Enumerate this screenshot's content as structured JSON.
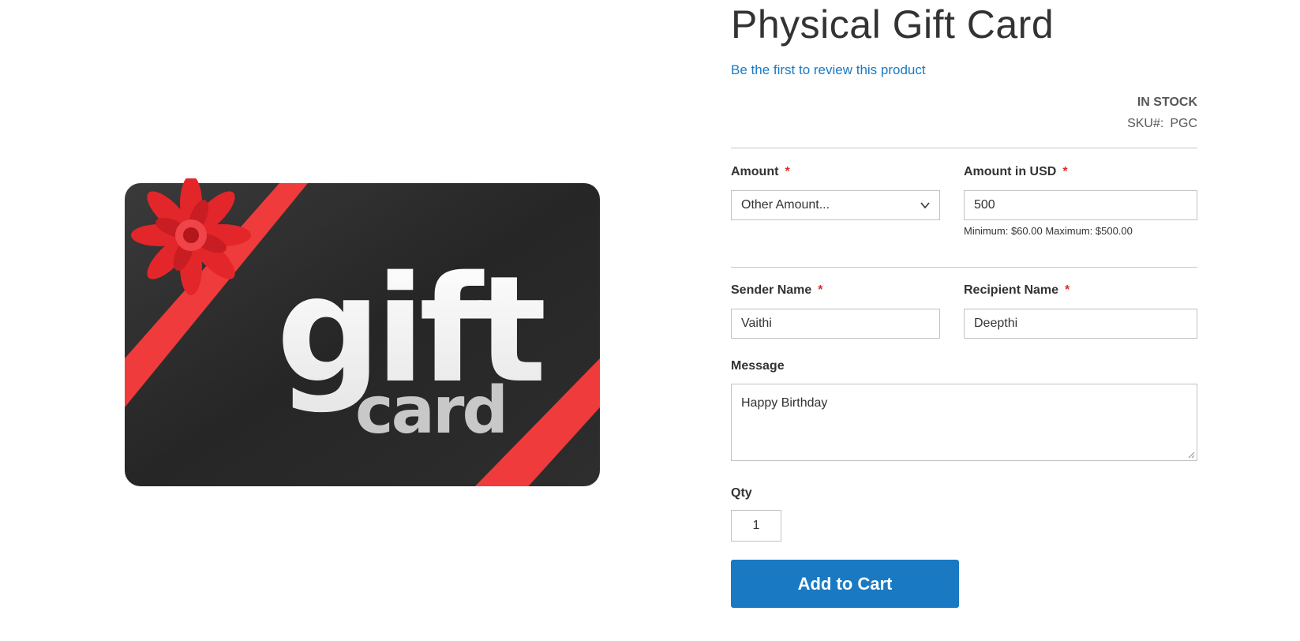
{
  "product": {
    "title": "Physical Gift Card",
    "review_link": "Be the first to review this product",
    "stock_status": "In stock",
    "sku_label": "SKU#:",
    "sku_value": "PGC"
  },
  "media": {
    "word_top": "gift",
    "word_bottom": "card",
    "card_color": "#2b2b2b",
    "ribbon_color": "#ef3b3b"
  },
  "form": {
    "amount": {
      "label": "Amount",
      "required_mark": "*",
      "selected": "Other Amount..."
    },
    "amount_usd": {
      "label": "Amount in USD",
      "required_mark": "*",
      "value": "500",
      "note": "Minimum: $60.00 Maximum: $500.00"
    },
    "sender": {
      "label": "Sender Name",
      "required_mark": "*",
      "value": "Vaithi"
    },
    "recipient": {
      "label": "Recipient Name",
      "required_mark": "*",
      "value": "Deepthi"
    },
    "message": {
      "label": "Message",
      "value": "Happy Birthday"
    },
    "qty": {
      "label": "Qty",
      "value": "1"
    },
    "add_to_cart": "Add to Cart"
  },
  "colors": {
    "accent": "#1979c3",
    "required": "#e02b27",
    "text": "#333333"
  }
}
